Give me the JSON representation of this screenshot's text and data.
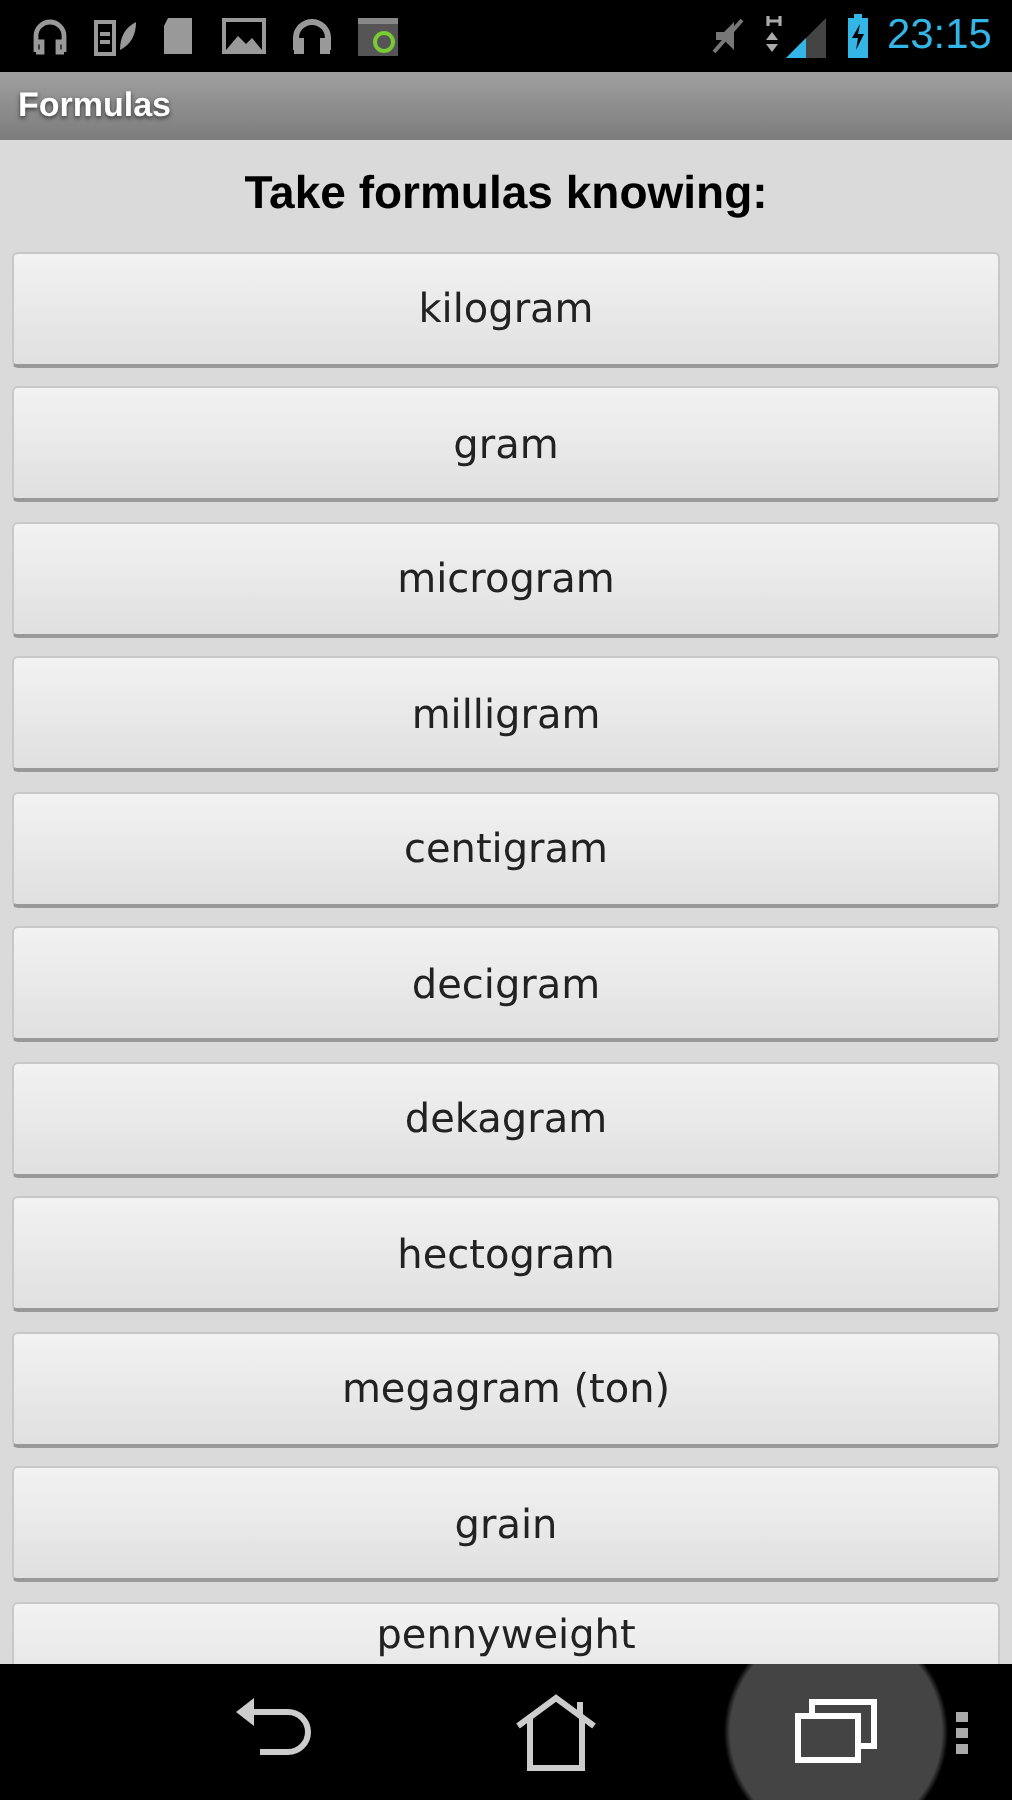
{
  "status_bar": {
    "time": "23:15"
  },
  "action_bar": {
    "title": "Formulas"
  },
  "heading": "Take formulas knowing:",
  "buttons": [
    "kilogram",
    "gram",
    "microgram",
    "milligram",
    "centigram",
    "decigram",
    "dekagram",
    "hectogram",
    "megagram (ton)",
    "grain",
    "pennyweight"
  ],
  "nav_bar": [
    {
      "kind": "back",
      "selected": false
    },
    {
      "kind": "home",
      "selected": false
    },
    {
      "kind": "recents",
      "selected": true
    }
  ]
}
